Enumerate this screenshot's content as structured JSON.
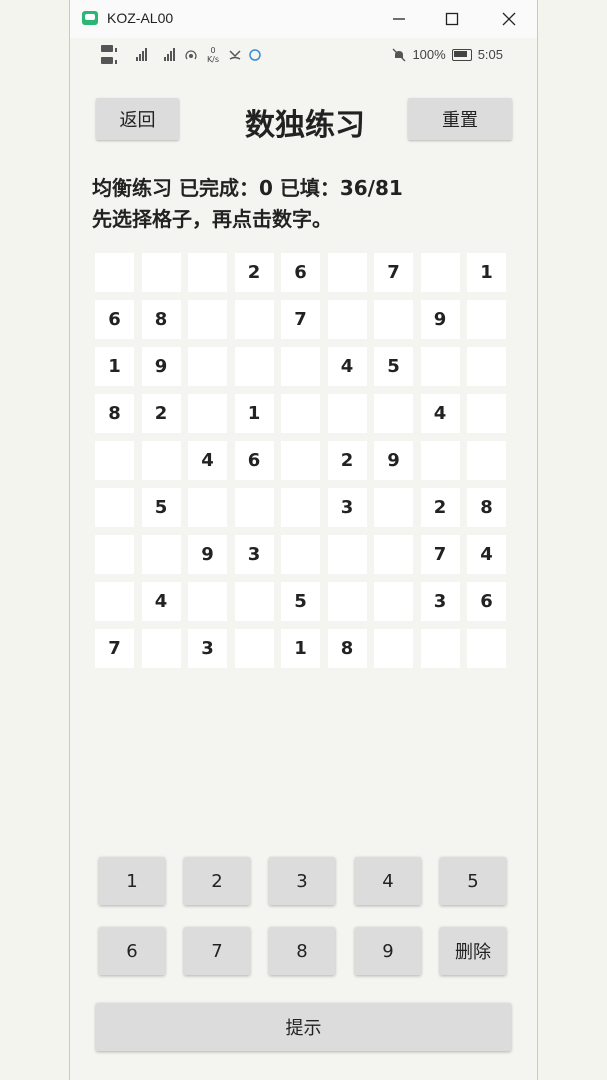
{
  "window": {
    "title": "KOZ-AL00"
  },
  "statusbar": {
    "battery": "100%",
    "time": "5:05",
    "speed": "0 K/s"
  },
  "header": {
    "back_label": "返回",
    "title": "数独练习",
    "reset_label": "重置"
  },
  "info": {
    "status": "均衡练习 已完成：0 已填：36/81",
    "instruction": "先选择格子，再点击数字。"
  },
  "board": [
    [
      "",
      "",
      "",
      "2",
      "6",
      "",
      "7",
      "",
      "1"
    ],
    [
      "6",
      "8",
      "",
      "",
      "7",
      "",
      "",
      "9",
      ""
    ],
    [
      "1",
      "9",
      "",
      "",
      "",
      "4",
      "5",
      "",
      ""
    ],
    [
      "8",
      "2",
      "",
      "1",
      "",
      "",
      "",
      "4",
      ""
    ],
    [
      "",
      "",
      "4",
      "6",
      "",
      "2",
      "9",
      "",
      ""
    ],
    [
      "",
      "5",
      "",
      "",
      "",
      "3",
      "",
      "2",
      "8"
    ],
    [
      "",
      "",
      "9",
      "3",
      "",
      "",
      "",
      "7",
      "4"
    ],
    [
      "",
      "4",
      "",
      "",
      "5",
      "",
      "",
      "3",
      "6"
    ],
    [
      "7",
      "",
      "3",
      "",
      "1",
      "8",
      "",
      "",
      ""
    ]
  ],
  "keypad": {
    "row1": [
      "1",
      "2",
      "3",
      "4",
      "5"
    ],
    "row2": [
      "6",
      "7",
      "8",
      "9",
      "删除"
    ]
  },
  "hint_label": "提示"
}
